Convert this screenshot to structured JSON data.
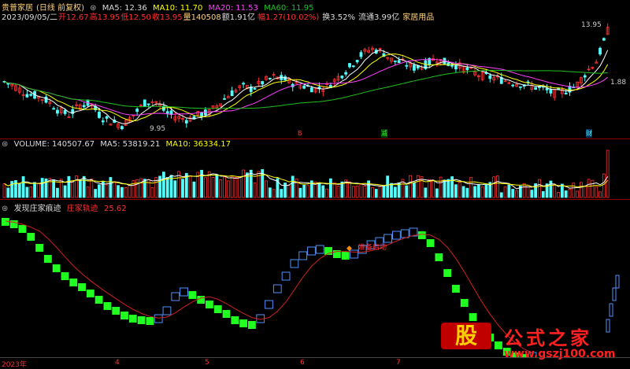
{
  "header": {
    "name": "贵普家居",
    "mode": "(日线 前复权)",
    "ma5_label": "MA5: 12.36",
    "ma10_label": "MA10: 11.70",
    "ma20_label": "MA20: 11.53",
    "ma60_label": "MA60: 11.95"
  },
  "quote": {
    "date": "2023/09/05/二",
    "open": "开12.67",
    "high": "高13.95",
    "low": "低12.50",
    "close": "收13.95",
    "vol": "量140508",
    "amount": "额1.91亿",
    "change": "幅1.27(10.02%)",
    "turnover": "换3.52%",
    "float": "流通3.99亿",
    "sector": "家居用品"
  },
  "price_chart": {
    "high_mark": "13.95",
    "low_mark": "9.95",
    "right_mark": "1.88",
    "event1": "B",
    "event2": "减",
    "event3": "财"
  },
  "volume": {
    "label": "VOLUME: 140507.67",
    "ma5": "MA5: 53819.21",
    "ma10": "MA10: 36334.17"
  },
  "indicator": {
    "name": "发现庄家痕迹",
    "line_label": "庄家轨迹",
    "line_value": "25.62",
    "signal": "准备启动"
  },
  "axis": {
    "labels": [
      "2023年",
      "4",
      "5",
      "6",
      "7"
    ]
  },
  "watermark": {
    "text1": "股",
    "text2": "公式之家",
    "url": "www.gszj100.com"
  },
  "colors": {
    "up": "#ff3030",
    "down": "#54ffff",
    "ma5": "#ffffff",
    "ma10": "#ffff00",
    "ma20": "#ff40ff",
    "ma60": "#20c020",
    "green_block": "#20ff20",
    "blue_block": "#5090ff"
  },
  "chart_data": {
    "type": "line",
    "price_points": [
      11.8,
      11.6,
      11.3,
      11.2,
      11.0,
      10.6,
      10.4,
      10.8,
      10.9,
      10.3,
      10.1,
      9.95,
      10.4,
      10.9,
      11.0,
      10.5,
      10.3,
      10.2,
      10.4,
      10.5,
      10.9,
      11.3,
      11.6,
      11.5,
      11.8,
      12.0,
      11.9,
      11.7,
      11.6,
      11.5,
      11.6,
      12.0,
      12.4,
      12.9,
      13.2,
      13.1,
      12.7,
      12.6,
      12.4,
      12.5,
      12.8,
      12.6,
      12.5,
      12.3,
      12.1,
      12.0,
      11.9,
      11.8,
      11.7,
      11.6,
      11.5,
      11.3,
      11.4,
      11.6,
      12.2,
      12.7,
      13.95
    ]
  }
}
